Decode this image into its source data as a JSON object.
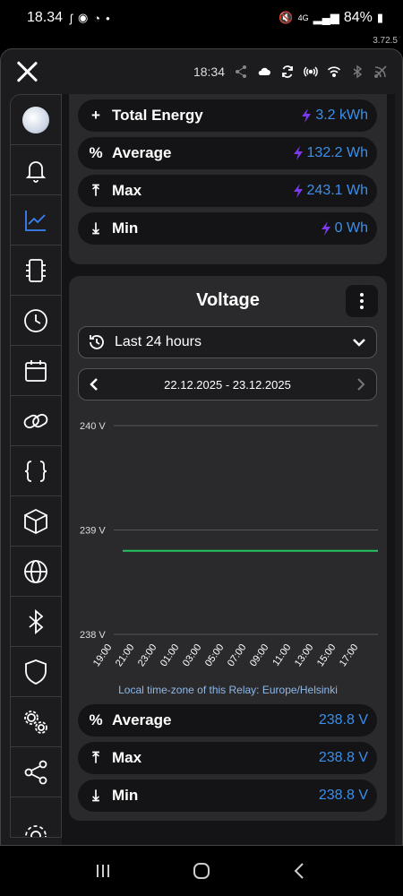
{
  "status_bar": {
    "time": "18.34",
    "battery": "84%",
    "network": "4G"
  },
  "app_version": "3.72.5",
  "topbar": {
    "time": "18:34"
  },
  "energy_card": {
    "rows": [
      {
        "icon": "+",
        "label": "Total Energy",
        "value": "3.2 kWh"
      },
      {
        "icon": "%",
        "label": "Average",
        "value": "132.2 Wh"
      },
      {
        "icon": "⤒",
        "label": "Max",
        "value": "243.1 Wh"
      },
      {
        "icon": "⤓",
        "label": "Min",
        "value": "0 Wh"
      }
    ]
  },
  "voltage_card": {
    "title": "Voltage",
    "range_label": "Last 24 hours",
    "date_range": "22.12.2025 - 23.12.2025",
    "timezone_note": "Local time-zone of this Relay: Europe/Helsinki",
    "stats": [
      {
        "icon": "%",
        "label": "Average",
        "value": "238.8 V"
      },
      {
        "icon": "⤒",
        "label": "Max",
        "value": "238.8 V"
      },
      {
        "icon": "⤓",
        "label": "Min",
        "value": "238.8 V"
      }
    ]
  },
  "chart_data": {
    "type": "line",
    "x": [
      "19:00",
      "21:00",
      "23:00",
      "01:00",
      "03:00",
      "05:00",
      "07:00",
      "09:00",
      "11:00",
      "13:00",
      "15:00",
      "17:00"
    ],
    "series": [
      {
        "values": [
          238.8,
          238.8,
          238.8,
          238.8,
          238.8,
          238.8,
          238.8,
          238.8,
          238.8,
          238.8,
          238.8,
          238.8
        ],
        "color": "#22c55e"
      }
    ],
    "y_ticks": [
      "240 V",
      "239 V",
      "238 V"
    ],
    "ylim": [
      238,
      240
    ],
    "grid": true
  },
  "colors": {
    "accent": "#3b8fea",
    "bolt": "#7c3aed",
    "series": "#22c55e"
  },
  "sidebar_icons": [
    "avatar",
    "bell-icon",
    "chart-icon",
    "device-icon",
    "clock-icon",
    "calendar-icon",
    "link-icon",
    "code-braces-icon",
    "cube-icon",
    "globe-icon",
    "bluetooth-icon",
    "shield-icon",
    "settings-gears-icon",
    "share-icon",
    "gear-icon"
  ]
}
